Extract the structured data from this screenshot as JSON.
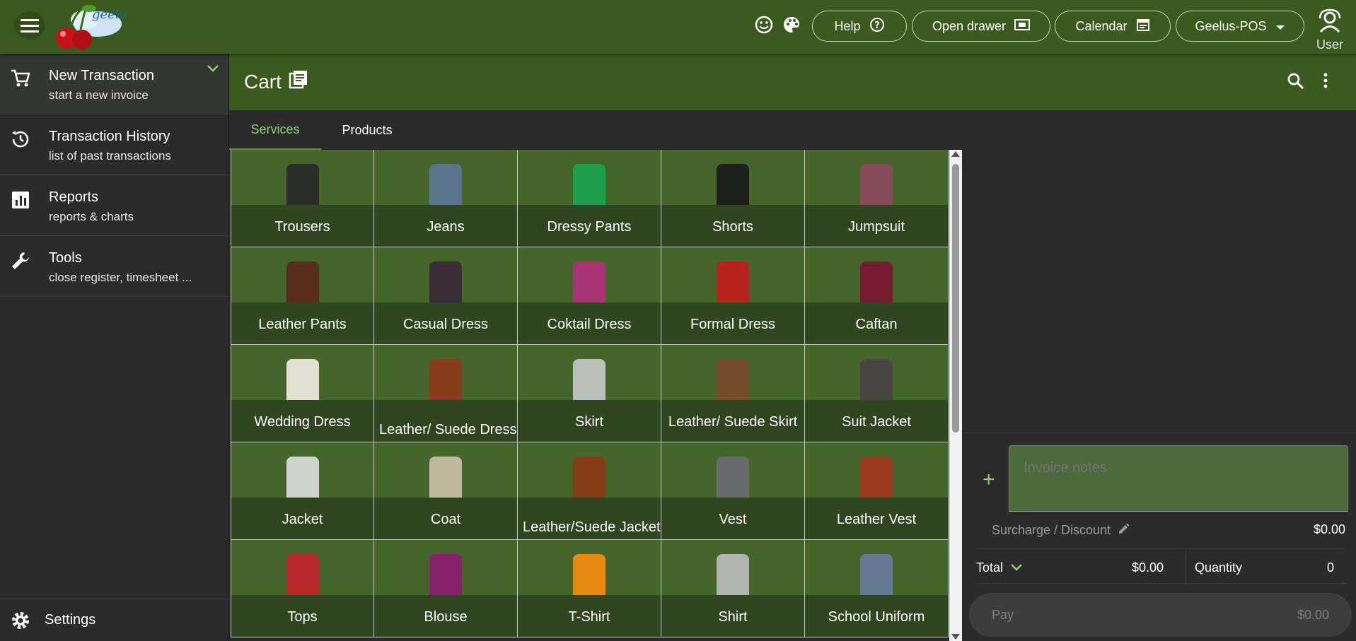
{
  "topbar": {
    "help_label": "Help",
    "drawer_label": "Open drawer",
    "calendar_label": "Calendar",
    "store_label": "Geelus-POS",
    "user_label": "User",
    "logo_text": "Geelus"
  },
  "sidebar": {
    "items": [
      {
        "title": "New Transaction",
        "subtitle": "start a new invoice",
        "icon": "cart-icon"
      },
      {
        "title": "Transaction History",
        "subtitle": "list of past transactions",
        "icon": "history-icon"
      },
      {
        "title": "Reports",
        "subtitle": "reports & charts",
        "icon": "chart-icon"
      },
      {
        "title": "Tools",
        "subtitle": "close register, timesheet ...",
        "icon": "wrench-icon"
      }
    ],
    "settings_label": "Settings"
  },
  "cart": {
    "title": "Cart",
    "tabs": [
      "Services",
      "Products"
    ]
  },
  "tiles": [
    {
      "label": "Trousers",
      "color": "#2a2a2a"
    },
    {
      "label": "Jeans",
      "color": "#5d7590"
    },
    {
      "label": "Dressy Pants",
      "color": "#1aa24f"
    },
    {
      "label": "Shorts",
      "color": "#1c1c1c"
    },
    {
      "label": "Jumpsuit",
      "color": "#8a4a5c"
    },
    {
      "label": "Leather Pants",
      "color": "#5a2a1a"
    },
    {
      "label": "Casual Dress",
      "color": "#3a2a3a"
    },
    {
      "label": "Coktail Dress",
      "color": "#b0307a"
    },
    {
      "label": "Formal Dress",
      "color": "#c0201f"
    },
    {
      "label": "Caftan",
      "color": "#7a1830"
    },
    {
      "label": "Wedding Dress",
      "color": "#eee7dc"
    },
    {
      "label": "Leather/ Suede Dress",
      "color": "#8c3a1e"
    },
    {
      "label": "Skirt",
      "color": "#c4c4c4"
    },
    {
      "label": "Leather/ Suede Skirt",
      "color": "#7a4a2a"
    },
    {
      "label": "Suit Jacket",
      "color": "#4a4642"
    },
    {
      "label": "Jacket",
      "color": "#d8d8d8"
    },
    {
      "label": "Coat",
      "color": "#c8bca4"
    },
    {
      "label": "Leather/Suede Jacket",
      "color": "#8a3a14"
    },
    {
      "label": "Vest",
      "color": "#6a6a74"
    },
    {
      "label": "Leather Vest",
      "color": "#a03a20"
    },
    {
      "label": "Tops",
      "color": "#c02828"
    },
    {
      "label": "Blouse",
      "color": "#8a2070"
    },
    {
      "label": "T-Shirt",
      "color": "#f08a10"
    },
    {
      "label": "Shirt",
      "color": "#b8b8b8"
    },
    {
      "label": "School Uniform",
      "color": "#6a7a9a"
    }
  ],
  "summary": {
    "notes_placeholder": "Invoice notes",
    "surcharge_label": "Surcharge / Discount",
    "surcharge_value": "$0.00",
    "total_label": "Total",
    "total_value": "$0.00",
    "quantity_label": "Quantity",
    "quantity_value": "0",
    "pay_label": "Pay",
    "pay_value": "$0.00"
  },
  "colors": {
    "header": "#3a5a1e",
    "accent": "#8fd26b",
    "tile": "#44662b"
  }
}
